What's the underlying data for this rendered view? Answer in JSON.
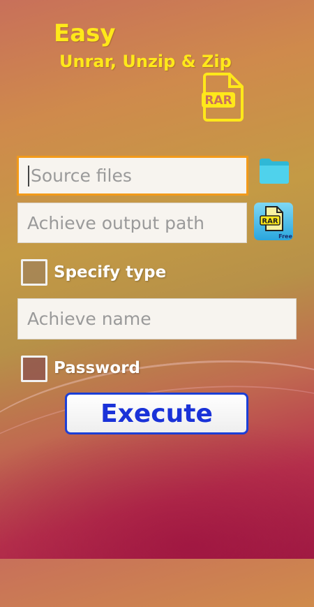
{
  "header": {
    "title_line1": "Easy",
    "title_line2": "Unrar, Unzip & Zip",
    "logo_text": "RAR"
  },
  "form": {
    "source_placeholder": "Source files",
    "output_placeholder": "Achieve output path",
    "output_icon_text": "RAR",
    "output_icon_badge": "Free",
    "specify_type_label": "Specify type",
    "name_placeholder": "Achieve name",
    "password_label": "Password",
    "execute_label": "Execute"
  },
  "colors": {
    "title": "#ffe81a",
    "accent_focus": "#f29a1a",
    "execute_text": "#1a32d8"
  }
}
